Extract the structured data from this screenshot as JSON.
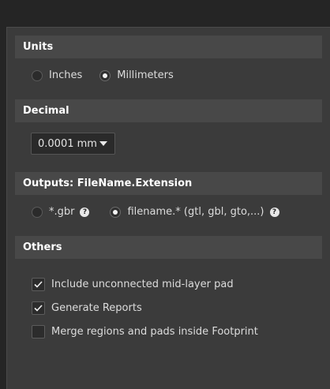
{
  "units": {
    "header": "Units",
    "options": [
      {
        "label": "Inches",
        "selected": false
      },
      {
        "label": "Millimeters",
        "selected": true
      }
    ]
  },
  "decimal": {
    "header": "Decimal",
    "selected_value": "0.0001 mm"
  },
  "outputs": {
    "header": "Outputs: FileName.Extension",
    "options": [
      {
        "label": "*.gbr",
        "selected": false
      },
      {
        "label": "filename.* (gtl, gbl, gto,...)",
        "selected": true
      }
    ],
    "help_glyph": "?"
  },
  "others": {
    "header": "Others",
    "checkboxes": [
      {
        "label": "Include unconnected mid-layer pad",
        "checked": true
      },
      {
        "label": "Generate Reports",
        "checked": true
      },
      {
        "label": "Merge regions and pads inside Footprint",
        "checked": false
      }
    ]
  },
  "colors": {
    "background": "#252525",
    "panel": "#3b3b3b",
    "header": "#484848",
    "text": "#dcdcdc"
  }
}
